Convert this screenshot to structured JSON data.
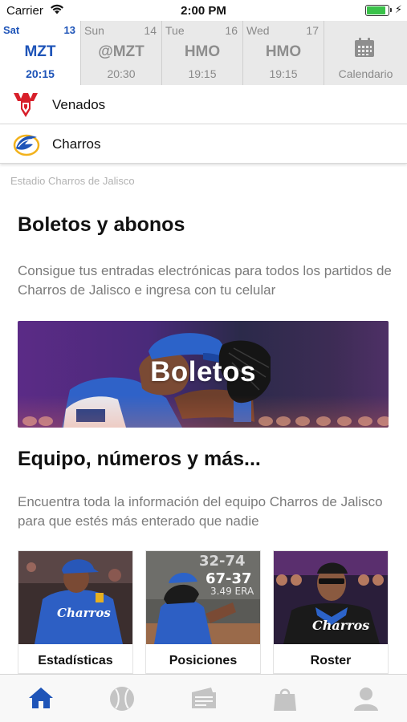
{
  "status_bar": {
    "carrier": "Carrier",
    "time": "2:00 PM",
    "battery_level": 0.85
  },
  "games": [
    {
      "day": "Sat",
      "date": "13",
      "opponent": "MZT",
      "time": "20:15",
      "selected": true
    },
    {
      "day": "Sun",
      "date": "14",
      "opponent": "@MZT",
      "time": "20:30",
      "selected": false
    },
    {
      "day": "Tue",
      "date": "16",
      "opponent": "HMO",
      "time": "19:15",
      "selected": false
    },
    {
      "day": "Wed",
      "date": "17",
      "opponent": "HMO",
      "time": "19:15",
      "selected": false
    }
  ],
  "calendar": {
    "label": "Calendario",
    "icon": "calendar-icon"
  },
  "teams": [
    {
      "name": "Venados",
      "icon": "venados-logo"
    },
    {
      "name": "Charros",
      "icon": "charros-logo"
    }
  ],
  "stadium": "Estadio Charros de Jalisco",
  "tickets": {
    "heading": "Boletos y abonos",
    "description": "Consigue tus entradas electrónicas para todos los partidos de Charros de Jalisco e ingresa con tu celular",
    "banner_title": "Boletos"
  },
  "team_section": {
    "heading": "Equipo, números y más...",
    "description": "Encuentra toda la información del equipo Charros de Jalisco para que estés más enterado que nadie",
    "cards": [
      {
        "label": "Estadísticas"
      },
      {
        "label": "Posiciones",
        "overlay_1": "32-74",
        "overlay_2": "67-37",
        "overlay_3": "3.49 ERA"
      },
      {
        "label": "Roster"
      }
    ]
  },
  "tabbar": {
    "items": [
      {
        "icon": "home-icon",
        "active": true
      },
      {
        "icon": "baseball-icon",
        "active": false
      },
      {
        "icon": "ticket-icon",
        "active": false
      },
      {
        "icon": "shopping-bag-icon",
        "active": false
      },
      {
        "icon": "profile-icon",
        "active": false
      }
    ]
  },
  "colors": {
    "accent": "#1e54b8",
    "inactive": "#bdbdbd",
    "text_secondary": "#7b7b7b"
  }
}
